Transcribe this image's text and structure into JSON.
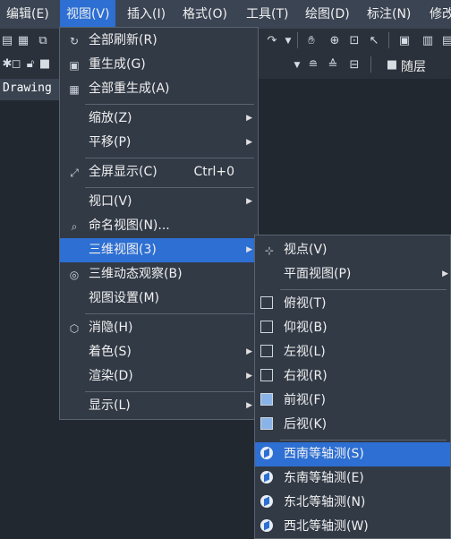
{
  "menubar": {
    "items": [
      {
        "label": "编辑(E)"
      },
      {
        "label": "视图(V)"
      },
      {
        "label": "插入(I)"
      },
      {
        "label": "格式(O)"
      },
      {
        "label": "工具(T)"
      },
      {
        "label": "绘图(D)"
      },
      {
        "label": "标注(N)"
      },
      {
        "label": "修改"
      }
    ]
  },
  "toolbar": {
    "layer_label": "随层"
  },
  "drawing_tab": {
    "label": "Drawing"
  },
  "view_menu": {
    "items": [
      {
        "label": "全部刷新(R)",
        "icon": "refresh-icon"
      },
      {
        "label": "重生成(G)",
        "icon": "regen-icon"
      },
      {
        "label": "全部重生成(A)",
        "icon": "regen-all-icon"
      },
      {
        "label": "缩放(Z)",
        "submenu": true
      },
      {
        "label": "平移(P)",
        "submenu": true
      },
      {
        "label": "全屏显示(C)",
        "shortcut": "Ctrl+0",
        "icon": "fullscreen-icon"
      },
      {
        "label": "视口(V)",
        "submenu": true
      },
      {
        "label": "命名视图(N)...",
        "icon": "named-view-icon"
      },
      {
        "label": "三维视图(3)",
        "submenu": true,
        "highlighted": true
      },
      {
        "label": "三维动态观察(B)",
        "icon": "orbit-icon"
      },
      {
        "label": "视图设置(M)"
      },
      {
        "label": "消隐(H)",
        "icon": "hide-icon"
      },
      {
        "label": "着色(S)",
        "submenu": true
      },
      {
        "label": "渲染(D)",
        "submenu": true
      },
      {
        "label": "显示(L)",
        "submenu": true
      }
    ]
  },
  "view3d_menu": {
    "items": [
      {
        "label": "视点(V)",
        "icon": "viewpoint-icon"
      },
      {
        "label": "平面视图(P)",
        "submenu": true
      },
      {
        "label": "俯视(T)",
        "icon": "top-view-icon"
      },
      {
        "label": "仰视(B)",
        "icon": "bottom-view-icon"
      },
      {
        "label": "左视(L)",
        "icon": "left-view-icon"
      },
      {
        "label": "右视(R)",
        "icon": "right-view-icon"
      },
      {
        "label": "前视(F)",
        "icon": "front-view-icon"
      },
      {
        "label": "后视(K)",
        "icon": "back-view-icon"
      },
      {
        "label": "西南等轴测(S)",
        "icon": "sw-iso-icon",
        "highlighted": true
      },
      {
        "label": "东南等轴测(E)",
        "icon": "se-iso-icon"
      },
      {
        "label": "东北等轴测(N)",
        "icon": "ne-iso-icon"
      },
      {
        "label": "西北等轴测(W)",
        "icon": "nw-iso-icon"
      }
    ]
  },
  "colors": {
    "menubar_bg": "#3b4453",
    "menu_bg": "#323a46",
    "highlight": "#2d6fd3",
    "canvas_bg": "#212830"
  }
}
